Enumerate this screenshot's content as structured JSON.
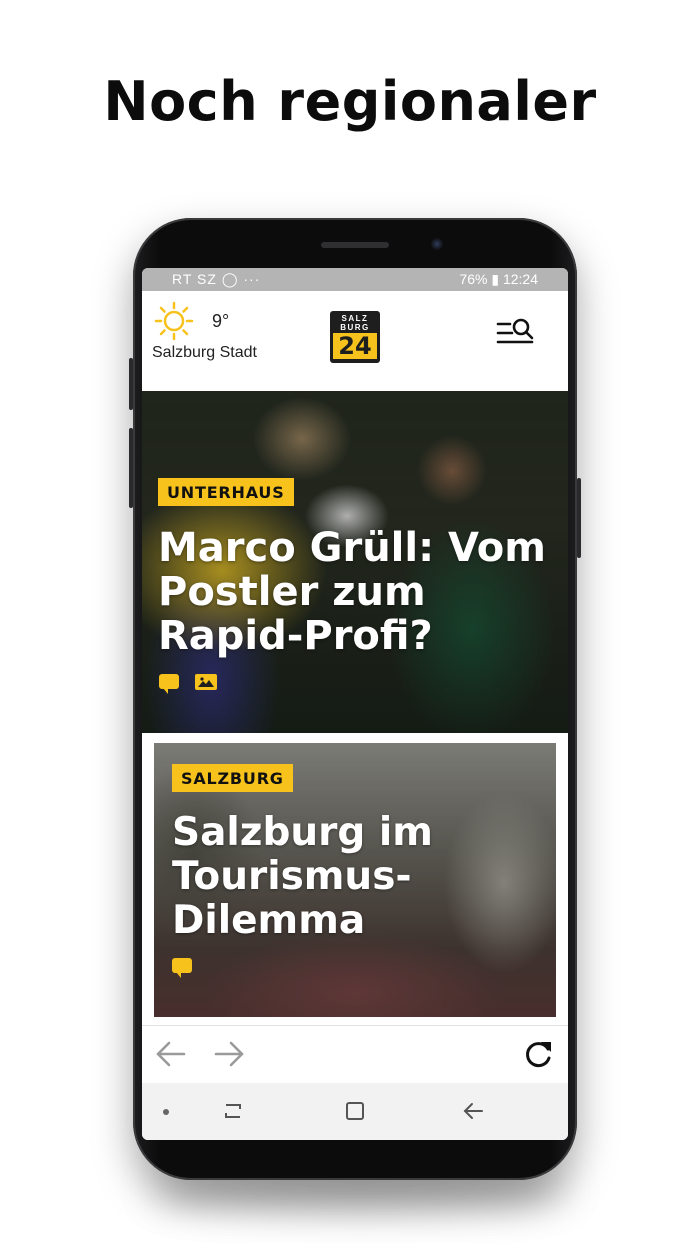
{
  "promo": {
    "headline": "Noch regionaler"
  },
  "status_bar": {
    "left_icons": "RT SZ ◯  ···",
    "battery": "76%",
    "time": "12:24"
  },
  "header": {
    "weather_icon": "sun-icon",
    "temperature": "9°",
    "location": "Salzburg Stadt",
    "logo_top": "SALZ\nBURG",
    "logo_number": "24",
    "menu_icon": "menu-search-icon"
  },
  "articles": [
    {
      "tag": "UNTERHAUS",
      "title_lines": [
        "Marco Grüll: Vom",
        "Postler zum",
        "Rapid-Profi?"
      ],
      "icons": [
        "comment-icon",
        "gallery-icon"
      ]
    },
    {
      "tag": "SALZBURG",
      "title_lines": [
        "Salzburg im",
        "Tourismus-",
        "Dilemma"
      ],
      "icons": [
        "comment-icon"
      ]
    }
  ],
  "browser_nav": {
    "back_icon": "arrow-left-icon",
    "forward_icon": "arrow-right-icon",
    "reload_icon": "reload-icon"
  },
  "colors": {
    "accent": "#f7c21b",
    "dark": "#1e1e1e"
  }
}
